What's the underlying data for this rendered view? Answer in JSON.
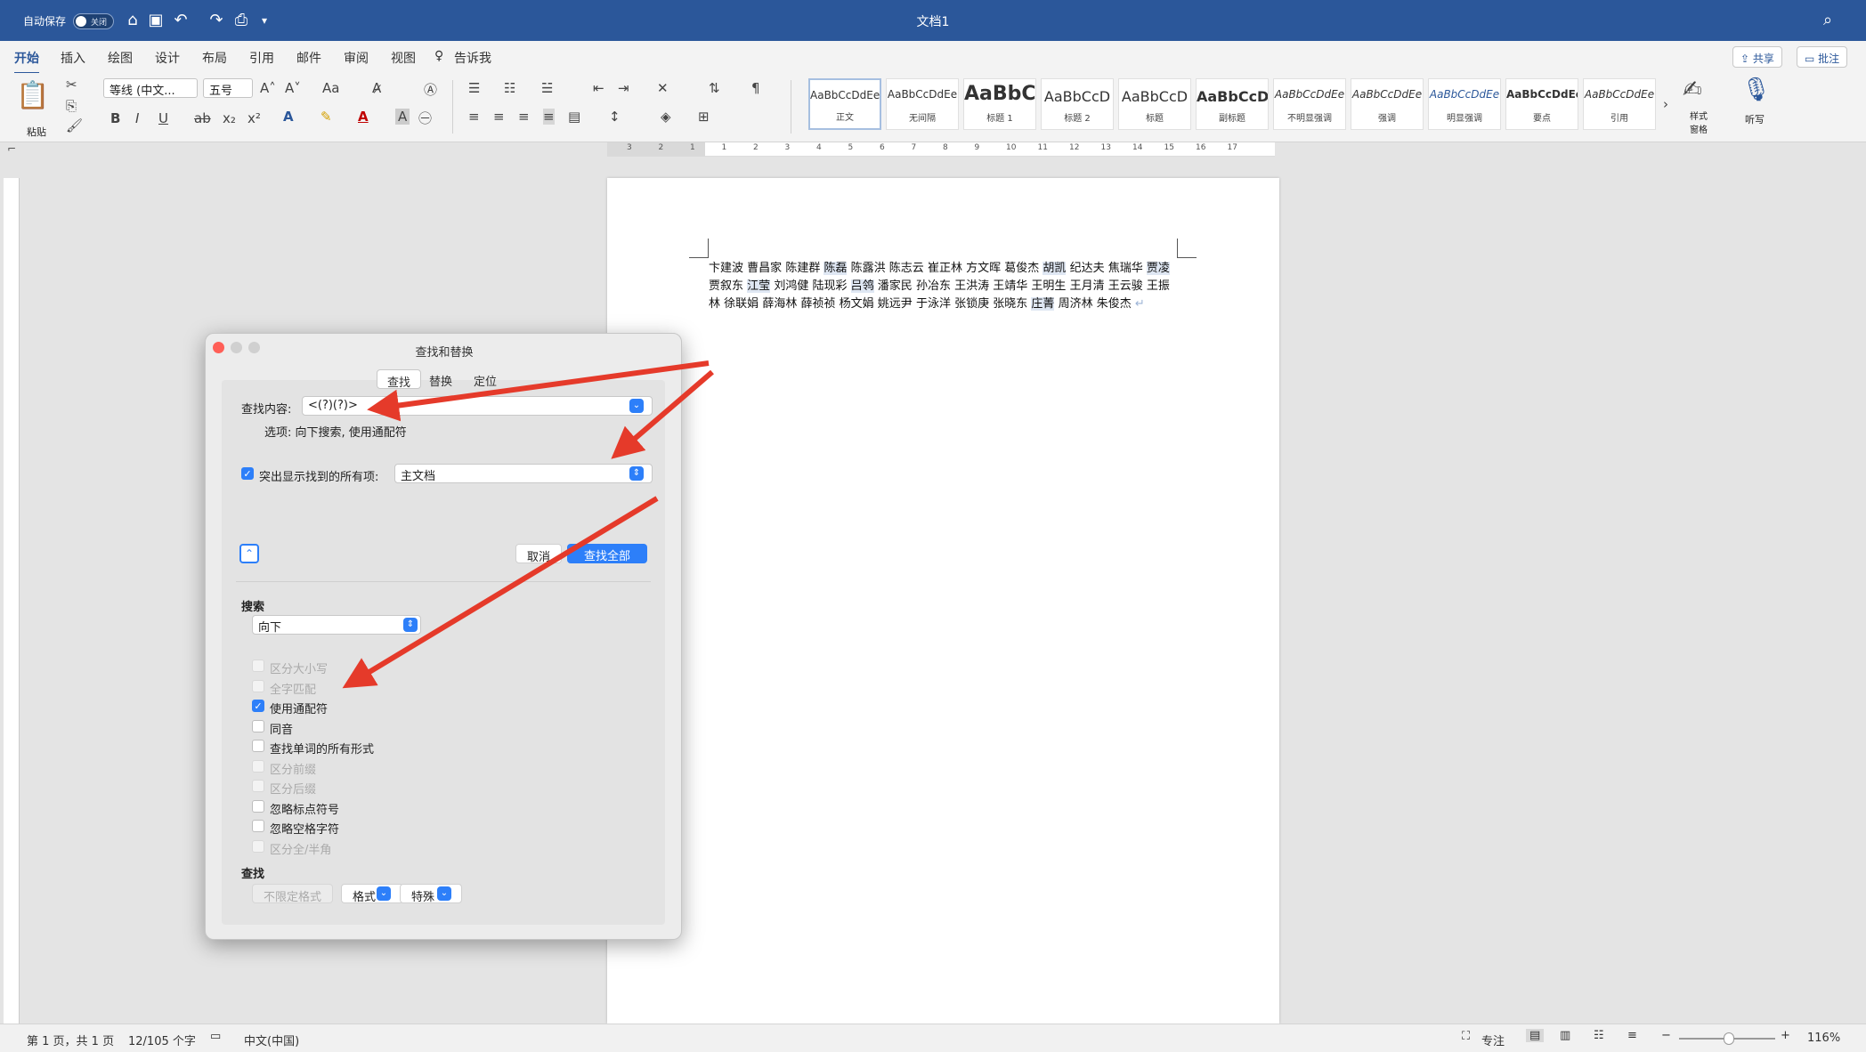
{
  "titlebar": {
    "autosave_label": "自动保存",
    "autosave_state": "关闭",
    "doc_title": "文档1"
  },
  "tabs": [
    "开始",
    "插入",
    "绘图",
    "设计",
    "布局",
    "引用",
    "邮件",
    "审阅",
    "视图"
  ],
  "tell_me": "告诉我",
  "header_buttons": {
    "share": "共享",
    "comments": "批注"
  },
  "ribbon": {
    "paste_label": "粘贴",
    "font_name": "等线 (中文...",
    "font_size": "五号",
    "styles": [
      {
        "preview": "AaBbCcDdEe",
        "name": "正文"
      },
      {
        "preview": "AaBbCcDdEe",
        "name": "无间隔"
      },
      {
        "preview": "AaBbC",
        "name": "标题 1"
      },
      {
        "preview": "AaBbCcD",
        "name": "标题 2"
      },
      {
        "preview": "AaBbCcD",
        "name": "标题"
      },
      {
        "preview": "AaBbCcD",
        "name": "副标题"
      },
      {
        "preview": "AaBbCcDdEe",
        "name": "不明显强调"
      },
      {
        "preview": "AaBbCcDdEe",
        "name": "强调"
      },
      {
        "preview": "AaBbCcDdEe",
        "name": "明显强调"
      },
      {
        "preview": "AaBbCcDdEe",
        "name": "要点"
      },
      {
        "preview": "AaBbCcDdEe",
        "name": "引用"
      }
    ],
    "styles_pane_label": "样式窗格",
    "dictate_label": "听写"
  },
  "ruler_numbers": [
    "3",
    "2",
    "1",
    "1",
    "2",
    "3",
    "4",
    "5",
    "6",
    "7",
    "8",
    "9",
    "10",
    "11",
    "12",
    "13",
    "14",
    "15",
    "16",
    "17"
  ],
  "document": {
    "names": [
      {
        "t": "卞建波",
        "h": false
      },
      {
        "t": "曹昌家",
        "h": false
      },
      {
        "t": "陈建群",
        "h": false
      },
      {
        "t": "陈磊",
        "h": true
      },
      {
        "t": "陈露洪",
        "h": false
      },
      {
        "t": "陈志云",
        "h": false
      },
      {
        "t": "崔正林",
        "h": false
      },
      {
        "t": "方文晖",
        "h": false
      },
      {
        "t": "葛俊杰",
        "h": false
      },
      {
        "t": "胡凯",
        "h": true
      },
      {
        "t": "纪达夫",
        "h": false
      },
      {
        "t": "焦瑞华",
        "h": false
      },
      {
        "t": "贾凌",
        "h": true
      },
      {
        "t": "贾叙东",
        "h": false
      },
      {
        "t": "江莹",
        "h": true
      },
      {
        "t": "刘鸿健",
        "h": false
      },
      {
        "t": "陆现彩",
        "h": false
      },
      {
        "t": "吕鸰",
        "h": true
      },
      {
        "t": "潘家民",
        "h": false
      },
      {
        "t": "孙冶东",
        "h": false
      },
      {
        "t": "王洪涛",
        "h": false
      },
      {
        "t": "王靖华",
        "h": false
      },
      {
        "t": "王明生",
        "h": false
      },
      {
        "t": "王月清",
        "h": false
      },
      {
        "t": "王云骏",
        "h": false
      },
      {
        "t": "王振林",
        "h": false
      },
      {
        "t": "徐联娟",
        "h": false
      },
      {
        "t": "薛海林",
        "h": false
      },
      {
        "t": "薛祯祯",
        "h": false
      },
      {
        "t": "杨文娟",
        "h": false
      },
      {
        "t": "姚远尹",
        "h": false
      },
      {
        "t": "于泳洋",
        "h": false
      },
      {
        "t": "张锁庚",
        "h": false
      },
      {
        "t": "张晓东",
        "h": false
      },
      {
        "t": "庄菁",
        "h": true
      },
      {
        "t": "周济林",
        "h": false
      },
      {
        "t": "朱俊杰",
        "h": false
      }
    ]
  },
  "dialog": {
    "title": "查找和替换",
    "tabs": [
      "查找",
      "替换",
      "定位"
    ],
    "find_label": "查找内容:",
    "find_value": "<(?)(?)>",
    "options_text": "选项: 向下搜索, 使用通配符",
    "highlight_label": "突出显示找到的所有项:",
    "highlight_scope": "主文档",
    "cancel": "取消",
    "find_all": "查找全部",
    "search_heading": "搜索",
    "search_direction": "向下",
    "options": [
      {
        "label": "区分大小写",
        "checked": false,
        "disabled": true
      },
      {
        "label": "全字匹配",
        "checked": false,
        "disabled": true
      },
      {
        "label": "使用通配符",
        "checked": true,
        "disabled": false
      },
      {
        "label": "同音",
        "checked": false,
        "disabled": false
      },
      {
        "label": "查找单词的所有形式",
        "checked": false,
        "disabled": false
      },
      {
        "label": "区分前缀",
        "checked": false,
        "disabled": true
      },
      {
        "label": "区分后缀",
        "checked": false,
        "disabled": true
      },
      {
        "label": "忽略标点符号",
        "checked": false,
        "disabled": false
      },
      {
        "label": "忽略空格字符",
        "checked": false,
        "disabled": false
      },
      {
        "label": "区分全/半角",
        "checked": false,
        "disabled": true
      }
    ],
    "find_heading": "查找",
    "no_format": "不限定格式",
    "format": "格式",
    "special": "特殊"
  },
  "statusbar": {
    "page": "第 1 页，共 1 页",
    "words": "12/105 个字",
    "language": "中文(中国)",
    "focus": "专注",
    "zoom": "116%"
  }
}
